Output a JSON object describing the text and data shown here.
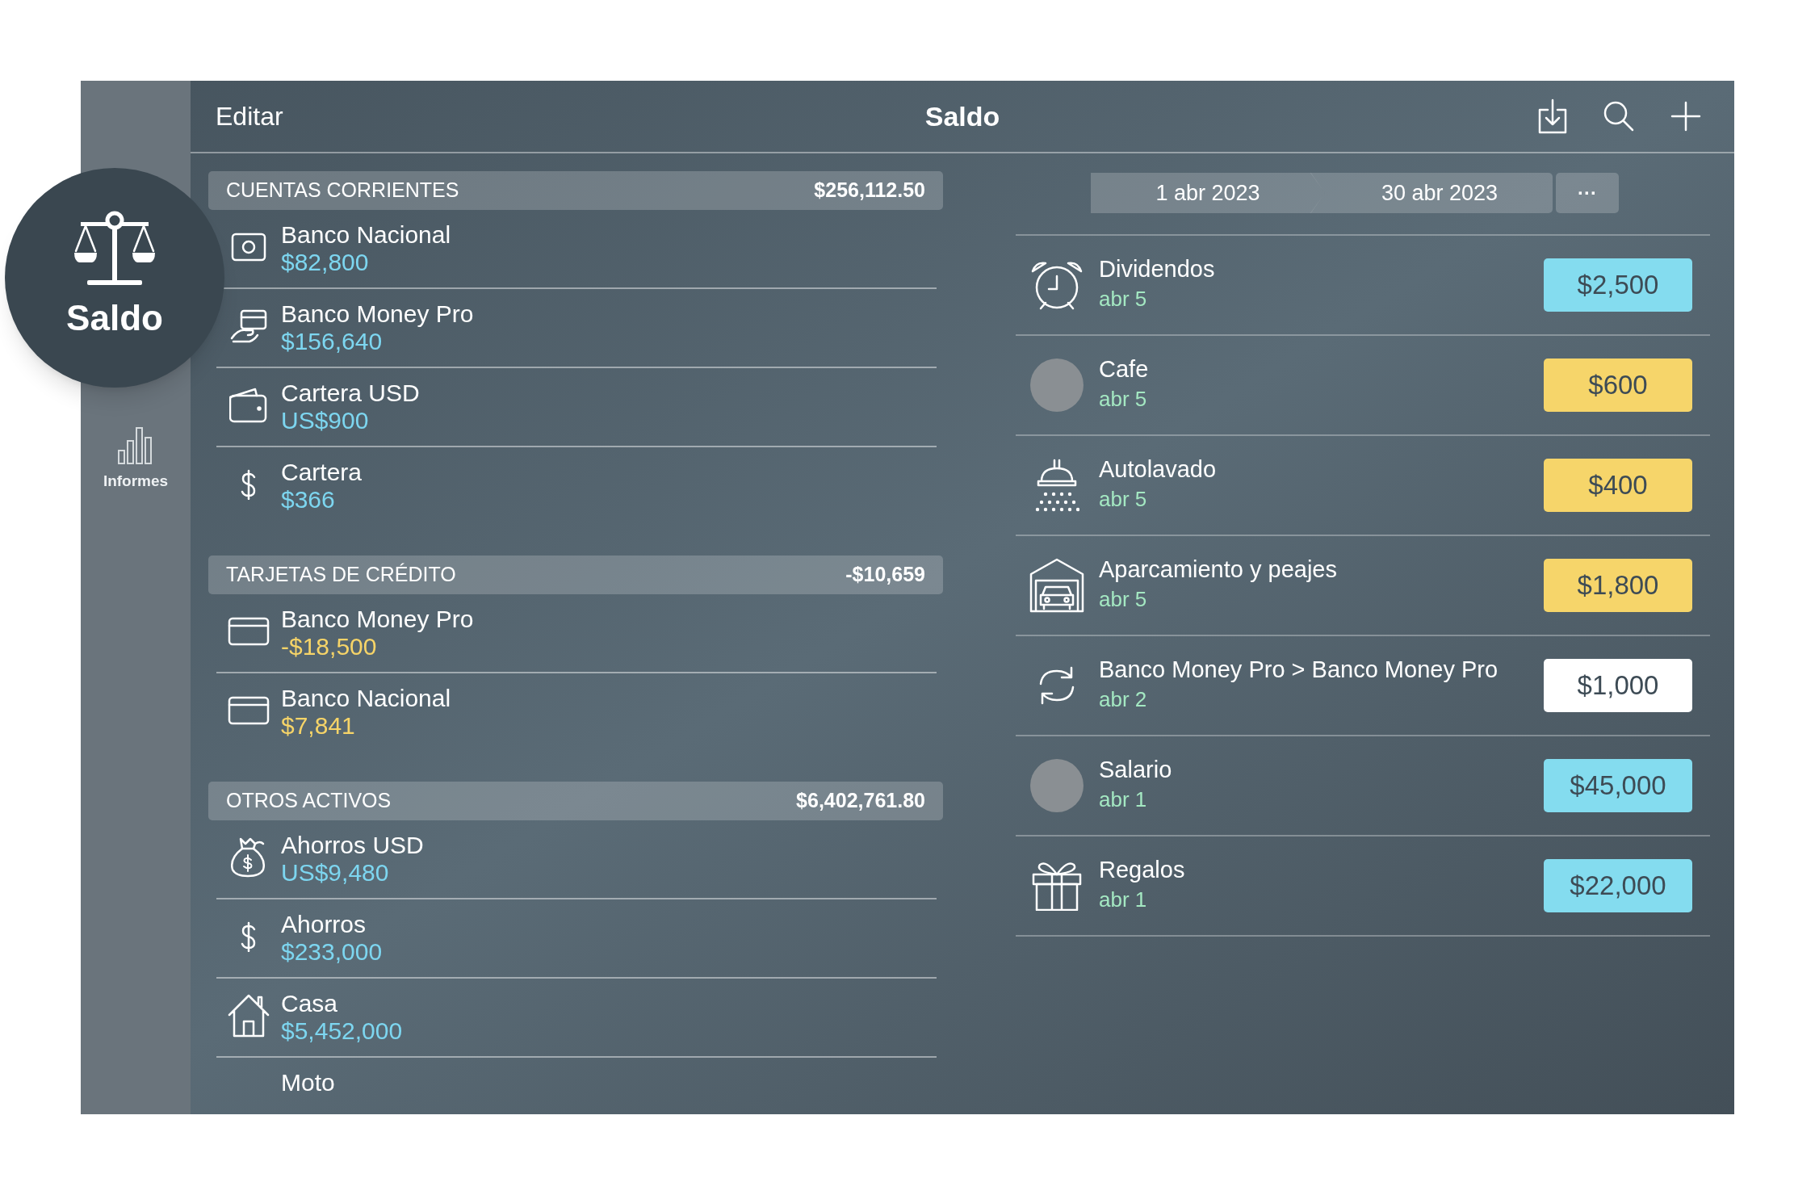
{
  "sidebar": {
    "items": [
      {
        "label": "Saldo",
        "selected": true
      },
      {
        "label": "Informes",
        "selected": false
      }
    ]
  },
  "toolbar": {
    "left": "Editar",
    "title": "Saldo"
  },
  "accounts": {
    "sections": [
      {
        "title": "CUENTAS CORRIENTES",
        "total": "$256,112.50",
        "kind": "asset",
        "items": [
          {
            "name": "Banco Nacional",
            "amount": "$82,800"
          },
          {
            "name": "Banco Money Pro",
            "amount": "$156,640"
          },
          {
            "name": "Cartera USD",
            "amount": "US$900"
          },
          {
            "name": "Cartera",
            "amount": "$366"
          }
        ]
      },
      {
        "title": "TARJETAS DE CRÉDITO",
        "total": "-$10,659",
        "kind": "credit",
        "items": [
          {
            "name": "Banco Money Pro",
            "amount": "-$18,500"
          },
          {
            "name": "Banco Nacional",
            "amount": "$7,841"
          }
        ]
      },
      {
        "title": "OTROS ACTIVOS",
        "total": "$6,402,761.80",
        "kind": "asset",
        "items": [
          {
            "name": "Ahorros USD",
            "amount": "US$9,480"
          },
          {
            "name": "Ahorros",
            "amount": "$233,000"
          },
          {
            "name": "Casa",
            "amount": "$5,452,000"
          },
          {
            "name": "Moto"
          }
        ]
      }
    ]
  },
  "period": {
    "start": "1 abr 2023",
    "end": "30 abr 2023",
    "more": "···"
  },
  "transactions": [
    {
      "name": "Dividendos",
      "date": "abr 5",
      "amount": "$2,500",
      "kind": "income"
    },
    {
      "name": "Cafe",
      "date": "abr 5",
      "amount": "$600",
      "kind": "expense"
    },
    {
      "name": "Autolavado",
      "date": "abr 5",
      "amount": "$400",
      "kind": "expense"
    },
    {
      "name": "Aparcamiento y peajes",
      "date": "abr 5",
      "amount": "$1,800",
      "kind": "expense"
    },
    {
      "name": "Banco Money Pro > Banco Money Pro",
      "date": "abr 2",
      "amount": "$1,000",
      "kind": "transfer"
    },
    {
      "name": "Salario",
      "date": "abr 1",
      "amount": "$45,000",
      "kind": "income"
    },
    {
      "name": "Regalos",
      "date": "abr 1",
      "amount": "$22,000",
      "kind": "income"
    }
  ]
}
